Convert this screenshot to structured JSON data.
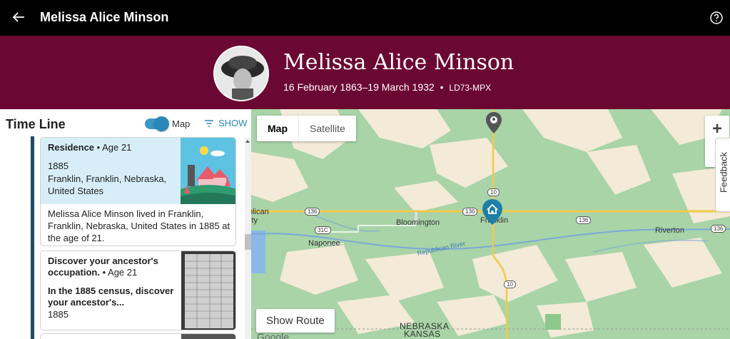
{
  "topbar": {
    "title": "Melissa Alice Minson",
    "back_icon": "arrow-left-icon",
    "help_icon": "help-circle-icon"
  },
  "header": {
    "name": "Melissa Alice Minson",
    "dates": "16 February 1863–19 March 1932",
    "separator": "•",
    "person_id": "LD73-MPX"
  },
  "timeline": {
    "title": "Time Line",
    "map_toggle_label": "Map",
    "show_label": "SHOW",
    "cards": [
      {
        "event": "Residence",
        "age": "• Age 21",
        "year": "1885",
        "place": "Franklin, Franklin, Nebraska, United States",
        "description": "Melissa Alice Minson lived in Franklin, Franklin, Nebraska, United States in 1885 at the age of 21."
      },
      {
        "event": "Discover your ancestor's occupation.",
        "age": "• Age 21",
        "subtitle": "In the 1885 census, discover your ancestor's...",
        "year": "1885"
      }
    ]
  },
  "map": {
    "type_map": "Map",
    "type_satellite": "Satellite",
    "zoom_in": "+",
    "zoom_out": "-",
    "feedback": "Feedback",
    "show_route": "Show Route",
    "google": "Google",
    "labels": {
      "republican_city": "blican",
      "city_fragment": "ity",
      "bloomington": "Bloomington",
      "franklin": "Franklin",
      "riverton": "Riverton",
      "naponee": "Naponee",
      "river": "Republican River",
      "nebraska": "NEBRASKA",
      "kansas": "KANSAS"
    },
    "shields": {
      "r136a": "136",
      "r136b": "136",
      "r136c": "136",
      "r136d": "136",
      "r10a": "10",
      "r10b": "10",
      "r31c": "31C"
    }
  },
  "colors": {
    "topbar": "#000000",
    "header": "#6b0733",
    "accent": "#2a88b8",
    "card_highlight": "#d7eef8",
    "timeline_line": "#1e4b63"
  }
}
